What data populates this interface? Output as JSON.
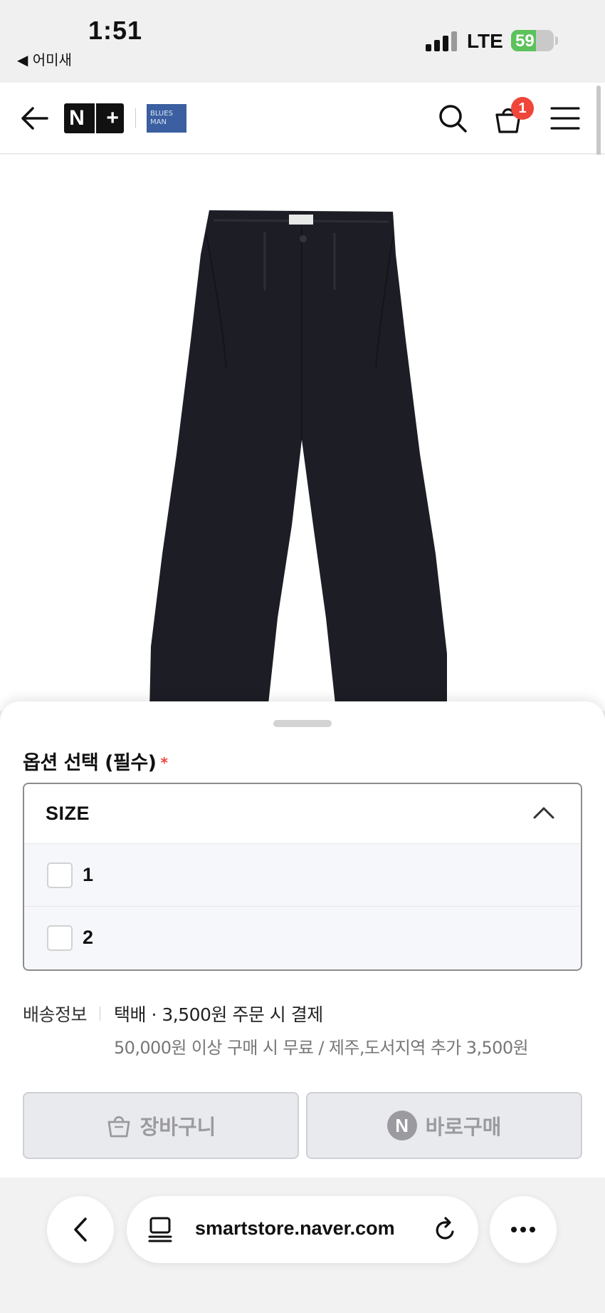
{
  "status_bar": {
    "time": "1:51",
    "back_app": "◀ 어미새",
    "network": "LTE",
    "battery": "59",
    "battery_level": 0.59
  },
  "header": {
    "nplus_n": "N",
    "nplus_plus": "+",
    "brand_logo": "BLUES MAN",
    "cart_count": "1"
  },
  "options": {
    "title": "옵션 선택 (필수)",
    "required_mark": "*",
    "select_label": "SIZE",
    "items": [
      {
        "label": "1",
        "checked": false
      },
      {
        "label": "2",
        "checked": false
      }
    ]
  },
  "shipping": {
    "label": "배송정보",
    "main": "택배 · 3,500원 주문 시 결제",
    "sub": "50,000원 이상 구매 시 무료 / 제주,도서지역 추가 3,500원"
  },
  "actions": {
    "cart_label": "장바구니",
    "buy_badge": "N",
    "buy_label": "바로구매"
  },
  "browser": {
    "url": "smartstore.naver.com"
  },
  "colors": {
    "accent_red": "#f0453a",
    "battery_green": "#5cc25b",
    "brand_blue": "#3b5fa0"
  }
}
